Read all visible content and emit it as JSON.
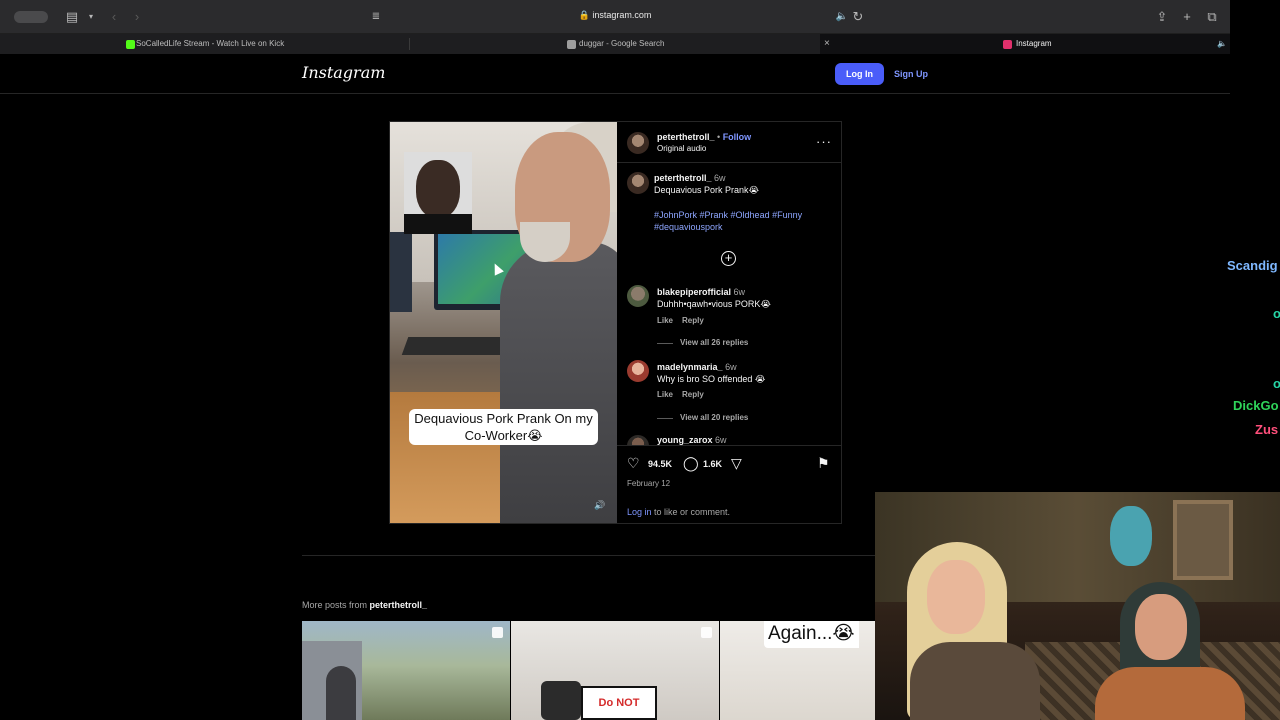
{
  "browser": {
    "url": "instagram.com",
    "tabs": [
      {
        "title": "SoCalledLife Stream - Watch Live on Kick",
        "color": "#53fc18"
      },
      {
        "title": "duggar - Google Search",
        "color": "#9e9e9e"
      },
      {
        "title": "Instagram",
        "color": "#e1306c"
      }
    ],
    "close_glyph": "×"
  },
  "header": {
    "logo": "Instagram",
    "login_label": "Log In",
    "signup_label": "Sign Up"
  },
  "post": {
    "video_caption": "Dequavious Pork Prank On my Co-Worker😭",
    "author": "peterthetroll_",
    "follow_label": "Follow",
    "audio_label": "Original audio",
    "caption_author": "peterthetroll_",
    "caption_age": "6w",
    "caption_text": "Dequavious Pork Prank😭",
    "hashtags": "#JohnPork #Prank #Oldhead #Funny #dequaviouspork",
    "comments": [
      {
        "user": "blakepiperofficial",
        "age": "6w",
        "text": "Duhhh•qawh•vious PORK😭",
        "like": "Like",
        "reply": "Reply",
        "view_replies": "View all 26 replies"
      },
      {
        "user": "madelynmaria_",
        "age": "6w",
        "text": "Why is bro SO offended 😭",
        "like": "Like",
        "reply": "Reply",
        "view_replies": "View all 20 replies"
      },
      {
        "user": "young_zarox",
        "age": "6w"
      }
    ],
    "likes": "94.5K",
    "comment_count": "1.6K",
    "date": "February 12",
    "login_prompt_link": "Log in",
    "login_prompt_rest": " to like or comment."
  },
  "more_posts": {
    "label": "More posts from ",
    "user": "peterthetroll_",
    "thumb3_text": "Again...😭",
    "thumb2_sign": "Do NOT ANSE"
  },
  "stream_chat": [
    {
      "name": "Scandig",
      "color": "#7fb8ff"
    },
    {
      "name": "o",
      "color": "#27d6a7"
    },
    {
      "name": "o",
      "color": "#27d6a7"
    },
    {
      "name": "DickGo",
      "color": "#2fd35a"
    },
    {
      "name": "Zus",
      "color": "#ff4f7b"
    }
  ]
}
